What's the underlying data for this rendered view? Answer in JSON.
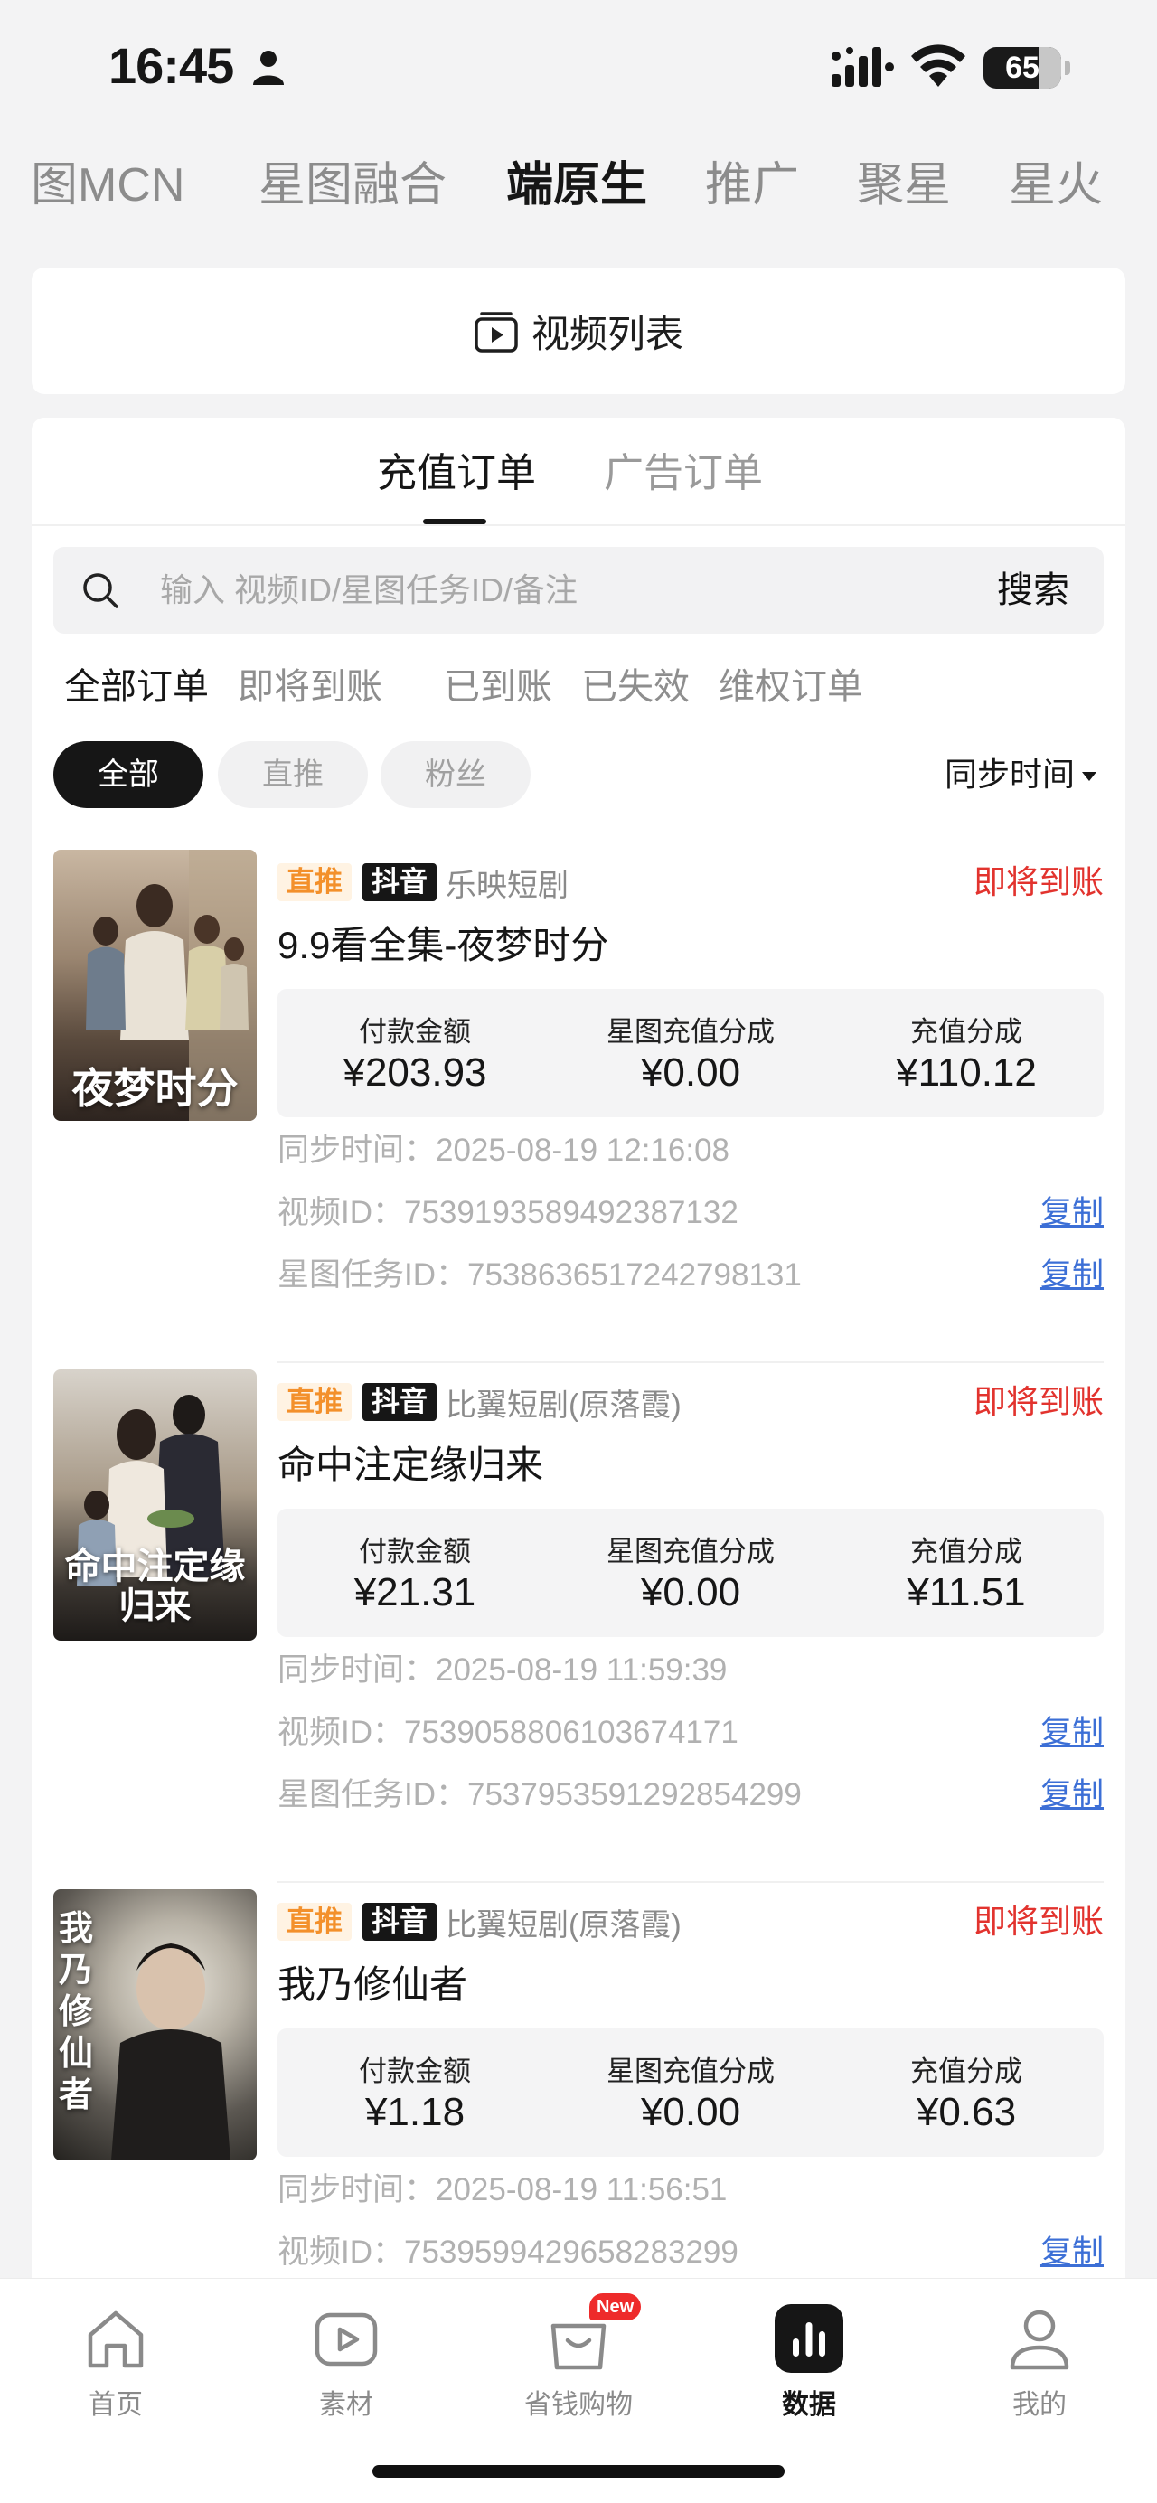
{
  "status_bar": {
    "time": "16:45",
    "battery": "65"
  },
  "top_tabs": [
    {
      "label": "图MCN",
      "active": false
    },
    {
      "label": "星图融合",
      "active": false
    },
    {
      "label": "端原生",
      "active": true
    },
    {
      "label": "推广",
      "active": false
    },
    {
      "label": "聚星",
      "active": false
    },
    {
      "label": "星火",
      "active": false
    }
  ],
  "video_list": {
    "label": "视频列表",
    "icon": "video-list-icon"
  },
  "order_tabs": [
    {
      "label": "充值订单",
      "active": true
    },
    {
      "label": "广告订单",
      "active": false
    }
  ],
  "search": {
    "placeholder": "输入 视频ID/星图任务ID/备注",
    "button": "搜索"
  },
  "status_filters": [
    {
      "label": "全部订单",
      "active": true
    },
    {
      "label": "即将到账",
      "active": false
    },
    {
      "label": "已到账",
      "active": false
    },
    {
      "label": "已失效",
      "active": false
    },
    {
      "label": "维权订单",
      "active": false
    }
  ],
  "type_pills": [
    {
      "label": "全部",
      "active": true
    },
    {
      "label": "直推",
      "active": false
    },
    {
      "label": "粉丝",
      "active": false
    }
  ],
  "sort": {
    "label": "同步时间"
  },
  "orders": [
    {
      "tag_type": "直推",
      "tag_platform": "抖音",
      "source": "乐映短剧",
      "status": "即将到账",
      "title": "9.9看全集-夜梦时分",
      "thumb_text": "夜梦时分",
      "amounts": [
        {
          "label": "付款金额",
          "value": "¥203.93"
        },
        {
          "label": "星图充值分成",
          "value": "¥0.00"
        },
        {
          "label": "充值分成",
          "value": "¥110.12"
        }
      ],
      "sync_time": "同步时间：2025-08-19 12:16:08",
      "video_id": "视频ID：7539193589492387132",
      "task_id": "星图任务ID：7538636517242798131",
      "copy_label": "复制"
    },
    {
      "tag_type": "直推",
      "tag_platform": "抖音",
      "source": "比翼短剧(原落霞)",
      "status": "即将到账",
      "title": "命中注定缘归来",
      "thumb_text": "命中注定缘归来",
      "amounts": [
        {
          "label": "付款金额",
          "value": "¥21.31"
        },
        {
          "label": "星图充值分成",
          "value": "¥0.00"
        },
        {
          "label": "充值分成",
          "value": "¥11.51"
        }
      ],
      "sync_time": "同步时间：2025-08-19 11:59:39",
      "video_id": "视频ID：7539058806103674171",
      "task_id": "星图任务ID：7537953591292854299",
      "copy_label": "复制"
    },
    {
      "tag_type": "直推",
      "tag_platform": "抖音",
      "source": "比翼短剧(原落霞)",
      "status": "即将到账",
      "title": "我乃修仙者",
      "thumb_text": "我乃修仙者",
      "amounts": [
        {
          "label": "付款金额",
          "value": "¥1.18"
        },
        {
          "label": "星图充值分成",
          "value": "¥0.00"
        },
        {
          "label": "充值分成",
          "value": "¥0.63"
        }
      ],
      "sync_time": "同步时间：2025-08-19 11:56:51",
      "video_id": "视频ID：7539599429658283299",
      "copy_label": "复制"
    }
  ],
  "bottom_nav": [
    {
      "label": "首页",
      "icon": "home-icon",
      "active": false
    },
    {
      "label": "素材",
      "icon": "play-icon",
      "active": false
    },
    {
      "label": "省钱购物",
      "icon": "shopping-bag-icon",
      "active": false,
      "badge": "New"
    },
    {
      "label": "数据",
      "icon": "bar-chart-icon",
      "active": true
    },
    {
      "label": "我的",
      "icon": "user-icon",
      "active": false
    }
  ],
  "colors": {
    "accent_red": "#e2332e",
    "link_blue": "#3c6fd6",
    "tag_orange": "#f3902b"
  }
}
